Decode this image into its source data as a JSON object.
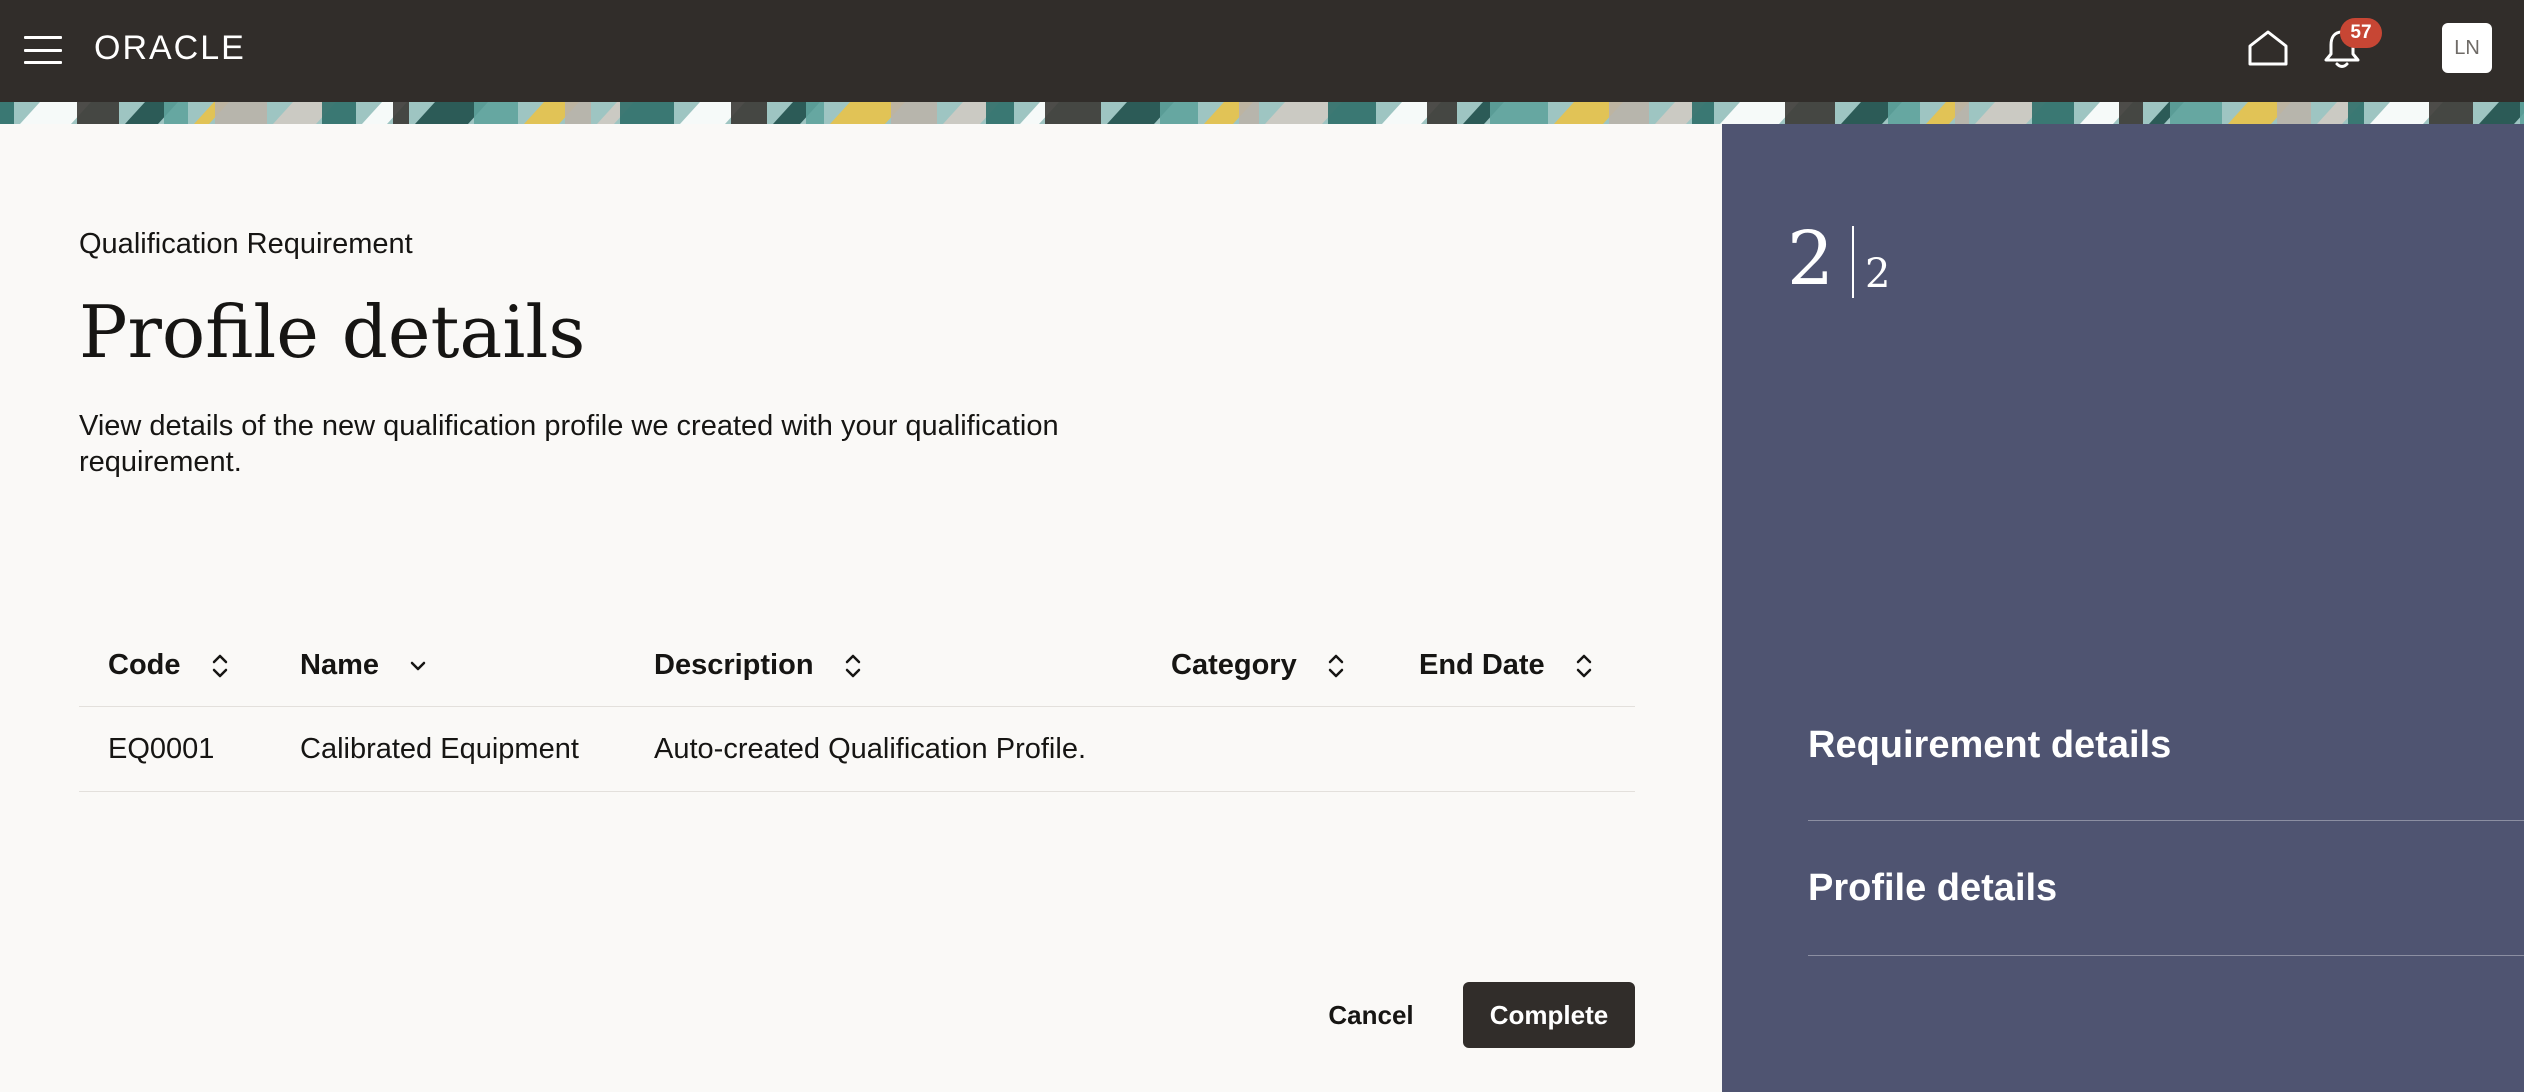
{
  "header": {
    "logo": "ORACLE",
    "notifications_count": "57",
    "user_initials": "LN"
  },
  "page": {
    "eyebrow": "Qualification Requirement",
    "title": "Profile details",
    "subtitle": "View details of the new qualification profile we created with your qualification requirement."
  },
  "table": {
    "columns": [
      "Code",
      "Name",
      "Description",
      "Category",
      "End Date"
    ],
    "rows": [
      {
        "code": "EQ0001",
        "name": "Calibrated Equipment",
        "description": "Auto-created Qualification Profile.",
        "category": "",
        "end_date": ""
      }
    ]
  },
  "actions": {
    "cancel": "Cancel",
    "complete": "Complete"
  },
  "progress": {
    "current": "2",
    "total": "2",
    "steps": [
      "Requirement details",
      "Profile details"
    ]
  },
  "colors": {
    "topbar": "#312d2a",
    "side_panel": "#4f5471",
    "badge": "#c74634",
    "primary_button": "#312d2a"
  }
}
